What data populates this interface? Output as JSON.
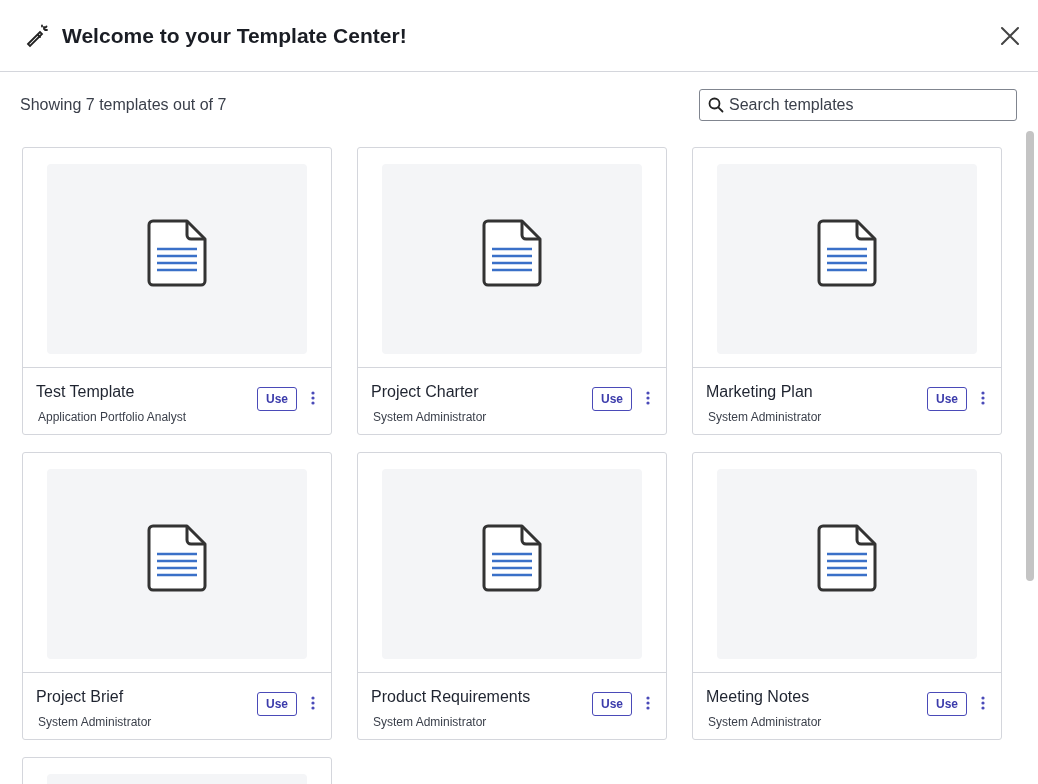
{
  "dialog": {
    "title": "Welcome to your Template Center!"
  },
  "summary": "Showing 7 templates out of 7",
  "search": {
    "placeholder": "Search templates"
  },
  "cards": [
    {
      "kind": "full",
      "title": "Test Template",
      "author": "Application Portfolio Analyst",
      "button": "Use"
    },
    {
      "kind": "full",
      "title": "Project Charter",
      "author": "System Administrator",
      "button": "Use"
    },
    {
      "kind": "full",
      "title": "Marketing Plan",
      "author": "System Administrator",
      "button": "Use"
    },
    {
      "kind": "full",
      "title": "Project Brief",
      "author": "System Administrator",
      "button": "Use"
    },
    {
      "kind": "full",
      "title": "Product Requirements",
      "author": "System Administrator",
      "button": "Use"
    },
    {
      "kind": "full",
      "title": "Meeting Notes",
      "author": "System Administrator",
      "button": "Use"
    },
    {
      "kind": "cut"
    }
  ]
}
